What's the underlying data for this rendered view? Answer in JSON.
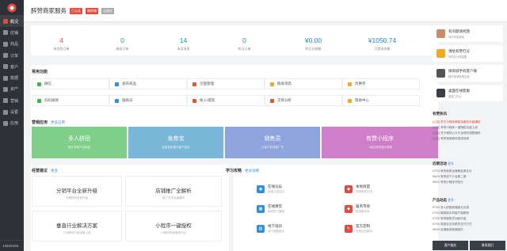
{
  "sidebar": {
    "items": [
      {
        "label": "概况"
      },
      {
        "label": "店铺"
      },
      {
        "label": "商品"
      },
      {
        "label": "订单"
      },
      {
        "label": "客户"
      },
      {
        "label": "数据"
      },
      {
        "label": "资产"
      },
      {
        "label": "营销"
      },
      {
        "label": "设置"
      },
      {
        "label": "应用"
      }
    ],
    "user": "13622192..."
  },
  "header": {
    "title": "醉赞商家服务",
    "tags": [
      "已认证",
      "微商城",
      "云服务"
    ]
  },
  "stats": [
    {
      "value": "4",
      "label": "待发货订单"
    },
    {
      "value": "0",
      "label": "维权订单"
    },
    {
      "value": "14",
      "label": "未读消息"
    },
    {
      "value": "0",
      "label": "昨日订单"
    },
    {
      "value": "¥0.00",
      "label": "昨日交易额"
    },
    {
      "value": "¥1050.74",
      "label": "可提现余额"
    }
  ],
  "common": {
    "title": "常用功能",
    "items": [
      "微信",
      "发布商品",
      "页面管理",
      "群发消息",
      "优惠券",
      "扫码收款",
      "轴商员",
      "收入/提现",
      "交易分析",
      "帮助中心"
    ]
  },
  "marketing": {
    "title": "营销应用",
    "more": "更多应用",
    "banners": [
      {
        "title": "多人拼团",
        "sub": "提升关联产品销量"
      },
      {
        "title": "发券宝",
        "sub": "拉新复购提升客户粘性"
      },
      {
        "title": "销售员",
        "sub": "让客户变成推广员"
      },
      {
        "title": "有赞小程序",
        "sub": "一键生成专属小程序"
      }
    ]
  },
  "operations": {
    "title": "经营建议",
    "more": "更多",
    "items": [
      {
        "title": "分销平台全新升级",
        "sub": "分佣机制全新升级"
      },
      {
        "title": "店铺推广全解析",
        "sub": "推广方式全面解析"
      },
      {
        "title": "垂直行业解决方案",
        "sub": "行业解决方案全新上线"
      },
      {
        "title": "小程序一键授权",
        "sub": "小程序快速授权开店"
      }
    ]
  },
  "learning": {
    "title": "学习攻略",
    "more": "更多攻略",
    "items": [
      {
        "title": "在线论坛",
        "sub": "运营交流社区"
      },
      {
        "title": "本地商盟",
        "sub": "同城商家交流"
      },
      {
        "title": "在线课堂",
        "sub": "商家学习课程"
      },
      {
        "title": "服务市场",
        "sub": "精选服务商"
      },
      {
        "title": "线下培训",
        "sub": "线下课程报名"
      },
      {
        "title": "官方定制",
        "sub": "专属定制服务"
      }
    ]
  },
  "right": {
    "cards": [
      {
        "title": "有问题请找我",
        "sub": "你的专属客服"
      },
      {
        "title": "请给有赞打分",
        "sub": "你的评价很重要"
      },
      {
        "title": "微商城手机客户端",
        "sub": "随时随地管理店铺"
      },
      {
        "title": "桌面在线客服",
        "sub": "客服工作台"
      }
    ],
    "news": {
      "title": "有赞快讯",
      "items": [
        "[公告] 关于小程序审核及服务升级通知",
        "[公告] 有赞小程序一键授权功能上线",
        "[公告] 关于微信公众平台规则调整通知",
        "[公告] 有赞商家服务费用说明"
      ]
    },
    "recent": {
      "title": "近期活动",
      "more": "更多",
      "items": [
        "07/04 有赞商家运营峰会报名中",
        "06/23 有赞线下沙龙第二期",
        "06/01 有赞小程序开放日"
      ]
    },
    "product": {
      "title": "产品动态",
      "more": "更多",
      "items": [
        "07/04 多人拼团新增团长优惠",
        "07/03 微商城手机客户端更新",
        "07/02 有赞销售员功能升级",
        "07/01 收银台支持更多支付方式",
        "06/30 店铺装修新增组件"
      ]
    },
    "service": [
      "客户服务",
      "联系我们"
    ]
  },
  "colors": {
    "sidebar": "#2e3138",
    "accent": "#1f8bd6",
    "b1": "#7fcf8a",
    "b2": "#7ab6d8",
    "b3": "#8fa3dc",
    "b4": "#cf7ec9"
  }
}
